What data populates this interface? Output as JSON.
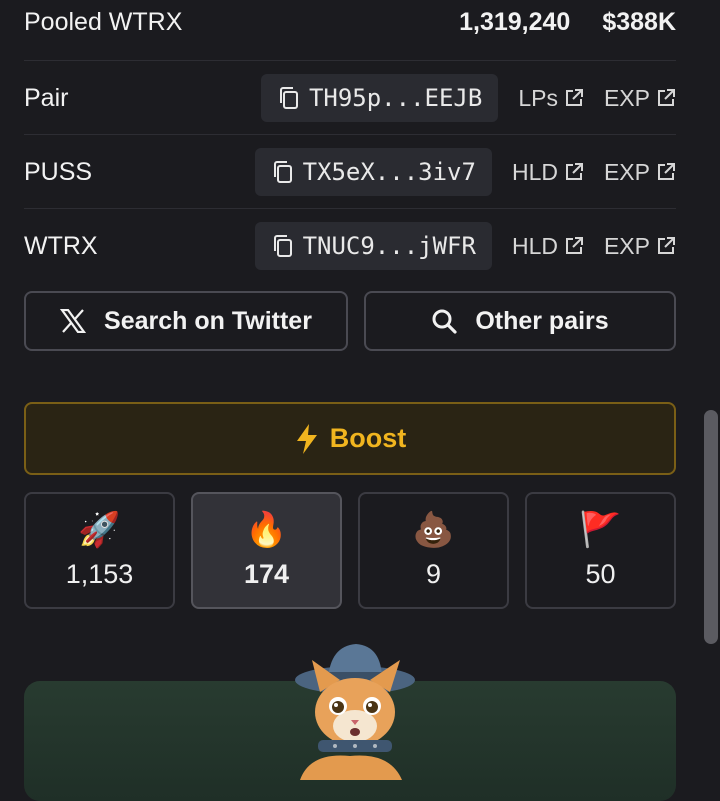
{
  "pooled": {
    "label": "Pooled WTRX",
    "amount": "1,319,240",
    "usd": "$388K"
  },
  "rows": [
    {
      "label": "Pair",
      "address": "TH95p...EEJB",
      "links": [
        "LPs",
        "EXP"
      ]
    },
    {
      "label": "PUSS",
      "address": "TX5eX...3iv7",
      "links": [
        "HLD",
        "EXP"
      ]
    },
    {
      "label": "WTRX",
      "address": "TNUC9...jWFR",
      "links": [
        "HLD",
        "EXP"
      ]
    }
  ],
  "buttons": {
    "twitter": "Search on Twitter",
    "pairs": "Other pairs"
  },
  "boost": {
    "label": "Boost",
    "color": "#f1b51f"
  },
  "stats": [
    {
      "emoji": "🚀",
      "icon": "rocket-icon",
      "count": "1,153"
    },
    {
      "emoji": "🔥",
      "icon": "fire-icon",
      "count": "174",
      "active": true
    },
    {
      "emoji": "💩",
      "icon": "poop-icon",
      "count": "9"
    },
    {
      "emoji": "🚩",
      "icon": "flag-icon",
      "count": "50"
    }
  ]
}
